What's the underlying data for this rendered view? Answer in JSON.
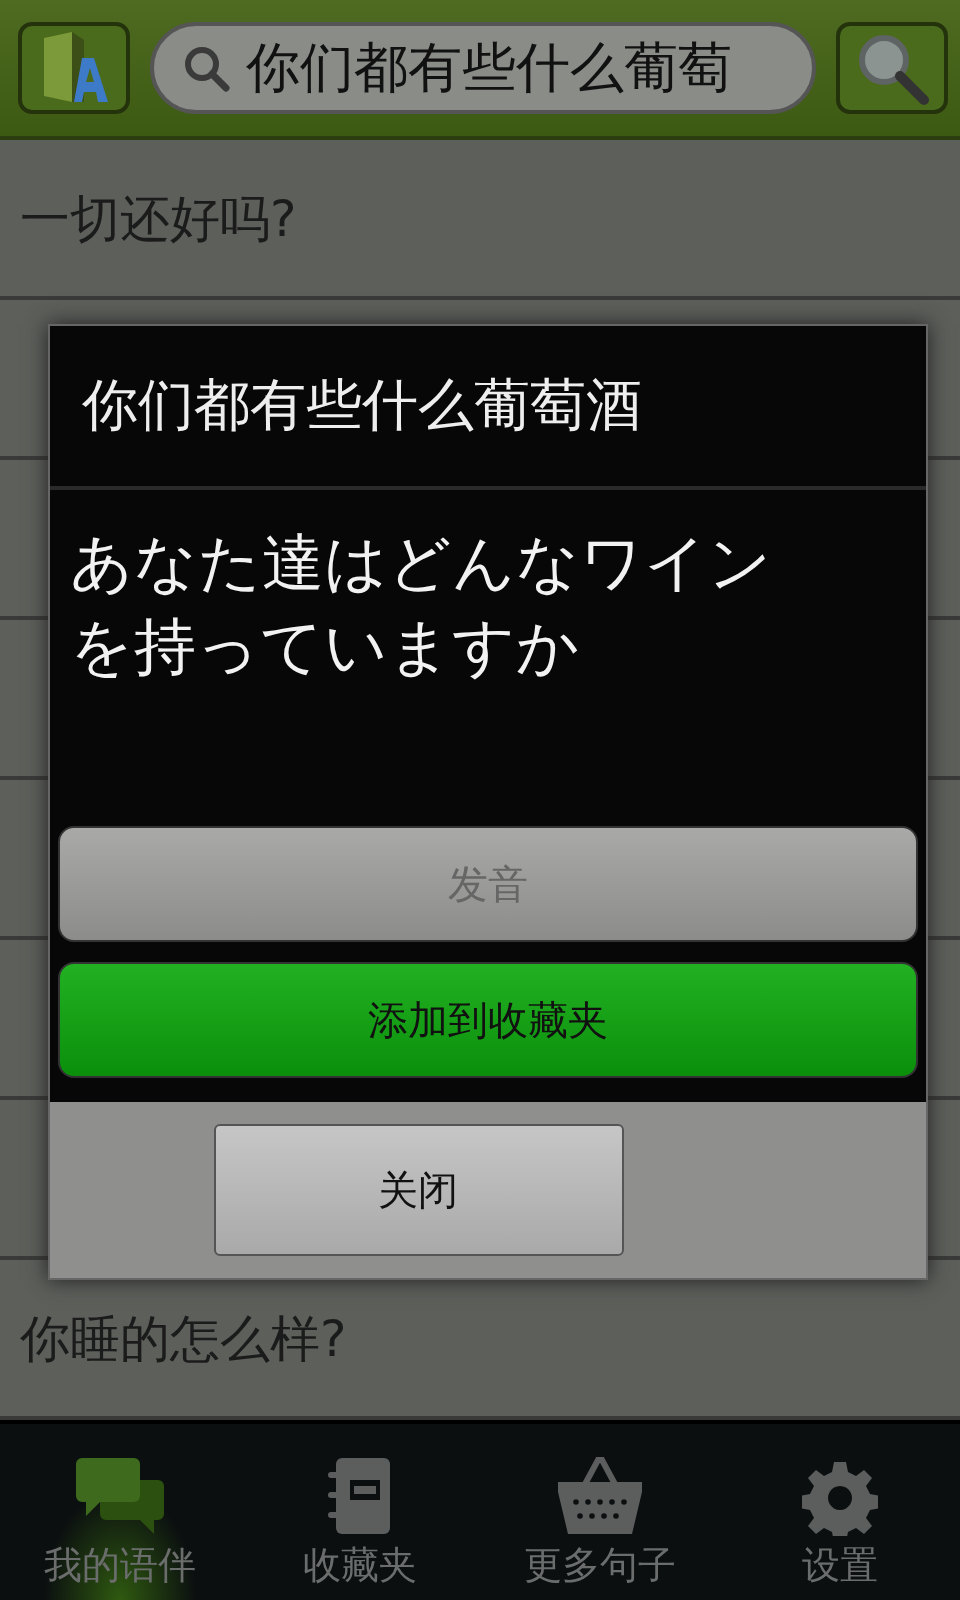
{
  "top_bar": {
    "search": {
      "value": "你们都有些什么葡萄"
    }
  },
  "list": [
    {
      "text": "一切还好吗?"
    },
    {
      "text": "你睡的怎么样?"
    }
  ],
  "dialog": {
    "title": "你们都有些什么葡萄酒",
    "message": "あなた達はどんなワインを持っていますか",
    "buttons": [
      {
        "label": "发音",
        "kind": "plain",
        "disabled": true
      },
      {
        "label": "添加到收藏夹",
        "kind": "primary",
        "disabled": false
      }
    ],
    "close": {
      "label": "关闭"
    }
  },
  "nav": [
    {
      "label": "我的语伴",
      "selected": true
    },
    {
      "label": "收藏夹",
      "selected": false
    },
    {
      "label": "更多句子",
      "selected": false
    },
    {
      "label": "设置",
      "selected": false
    }
  ]
}
